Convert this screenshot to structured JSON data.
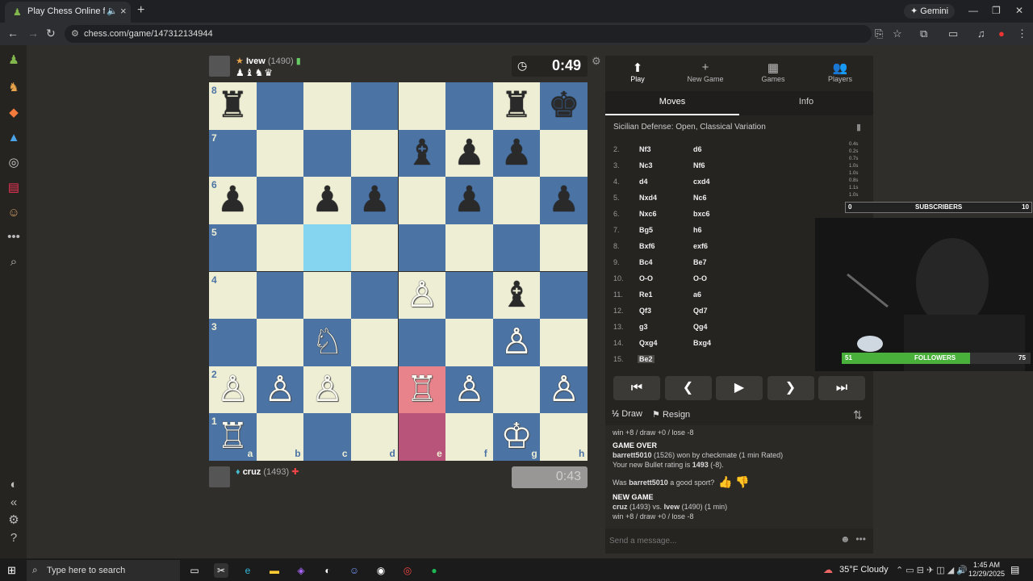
{
  "browser": {
    "tab_title": "Play Chess Online for FREE",
    "new_tab": "+",
    "gemini_label": "Gemini",
    "url": "chess.com/game/147312134944"
  },
  "top_player": {
    "name": "Ivew",
    "rating": "(1490)",
    "captured": "♟♝♞♛",
    "clock": "0:49"
  },
  "bottom_player": {
    "name": "cruz",
    "rating": "(1493)",
    "clock": "0:43"
  },
  "board": {
    "ranks": [
      "8",
      "7",
      "6",
      "5",
      "4",
      "3",
      "2",
      "1"
    ],
    "files": [
      "a",
      "b",
      "c",
      "d",
      "e",
      "f",
      "g",
      "h"
    ],
    "pieces": [
      "♜·····♜♚·",
      "····♝♟♟·",
      "♟·♟♟·♟·♟",
      "········",
      "····♙·♝·",
      "··♘···♙·",
      "♙♙♙·♖♙·♙",
      "♖·····♔·"
    ]
  },
  "panel": {
    "tabs": [
      {
        "label": "Play",
        "icon": "⬆"
      },
      {
        "label": "New Game",
        "icon": "+"
      },
      {
        "label": "Games",
        "icon": "▦"
      },
      {
        "label": "Players",
        "icon": "👥"
      }
    ],
    "subtabs": [
      "Moves",
      "Info"
    ],
    "opening": "Sicilian Defense: Open, Classical Variation",
    "moves": [
      {
        "no": "2.",
        "w": "Nf3",
        "b": "d6"
      },
      {
        "no": "3.",
        "w": "Nc3",
        "b": "Nf6"
      },
      {
        "no": "4.",
        "w": "d4",
        "b": "cxd4"
      },
      {
        "no": "5.",
        "w": "Nxd4",
        "b": "Nc6"
      },
      {
        "no": "6.",
        "w": "Nxc6",
        "b": "bxc6"
      },
      {
        "no": "7.",
        "w": "Bg5",
        "b": "h6"
      },
      {
        "no": "8.",
        "w": "Bxf6",
        "b": "exf6"
      },
      {
        "no": "9.",
        "w": "Bc4",
        "b": "Be7"
      },
      {
        "no": "10.",
        "w": "O-O",
        "b": "O-O"
      },
      {
        "no": "11.",
        "w": "Re1",
        "b": "a6"
      },
      {
        "no": "12.",
        "w": "Qf3",
        "b": "Qd7"
      },
      {
        "no": "13.",
        "w": "g3",
        "b": "Qg4"
      },
      {
        "no": "14.",
        "w": "Qxg4",
        "b": "Bxg4"
      },
      {
        "no": "15.",
        "w": "Be2",
        "b": ""
      }
    ],
    "controls": [
      "⏮",
      "❮",
      "▶",
      "❯",
      "⏭"
    ],
    "draw_label": "Draw",
    "resign_label": "Resign"
  },
  "chat": {
    "line0": "win +8 / draw +0 / lose -8",
    "game_over": "GAME OVER",
    "result_user": "barrett5010",
    "result_rest": "(1526) won by checkmate (1 min Rated)",
    "rating_pre": "Your new Bullet rating is",
    "rating_val": "1493",
    "rating_post": "(-8).",
    "sport_pre": "Was",
    "sport_user": "barrett5010",
    "sport_post": "a good sport?",
    "new_game": "NEW GAME",
    "ng_p1": "cruz",
    "ng_mid": "(1493) vs.",
    "ng_p2": "Ivew",
    "ng_rest": "(1490) (1 min)",
    "ng_stakes": "win +8 / draw +0 / lose -8",
    "placeholder": "Send a message..."
  },
  "overlay": {
    "stats": [
      "0.4s",
      "0.2s",
      "0.7s",
      "1.0s",
      "1.0s",
      "0.8s",
      "1.1s",
      "1.0s"
    ],
    "sub_left": "0",
    "sub_label": "SUBSCRIBERS",
    "sub_right": "10",
    "fol_left": "51",
    "fol_label": "FOLLOWERS",
    "fol_right": "75",
    "followers_fraction": 0.68
  },
  "taskbar": {
    "search": "Type here to search",
    "weather": "35°F  Cloudy",
    "time": "1:45 AM",
    "date": "12/29/2025"
  },
  "colors": {
    "light_square": "#eeeed5",
    "dark_square": "#4b73a3",
    "highlight_blue": "#85d5f0",
    "highlight_red": "#e8838b",
    "followers_green": "#49b03b"
  }
}
